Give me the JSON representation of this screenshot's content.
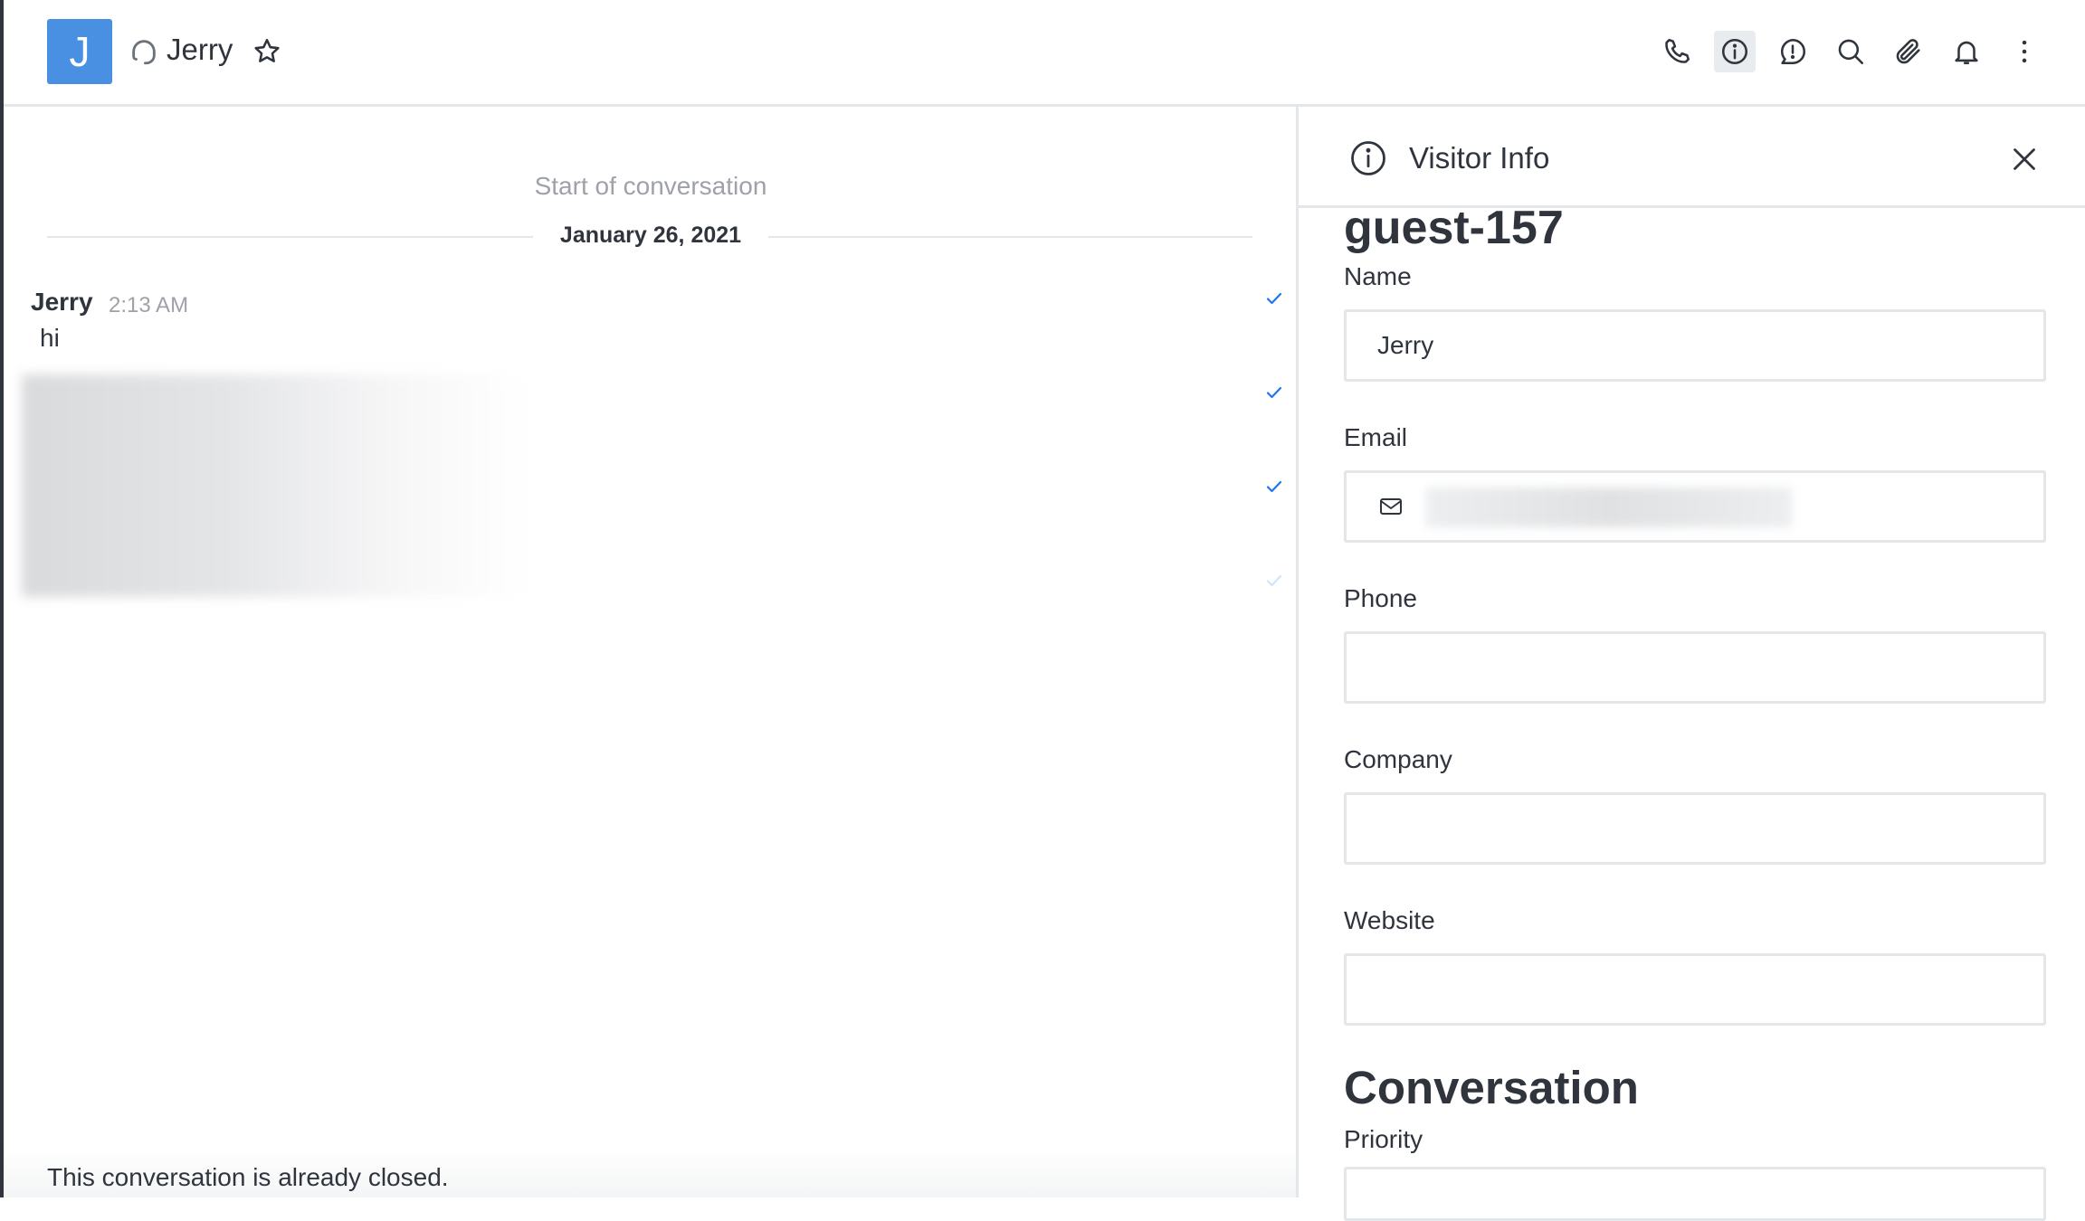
{
  "header": {
    "avatar_letter": "J",
    "room_name": "Jerry",
    "toolbar": [
      "phone-icon",
      "info-icon",
      "discussion-icon",
      "search-icon",
      "attachment-icon",
      "bell-icon",
      "kebab-menu-icon"
    ]
  },
  "chat": {
    "start_label": "Start of conversation",
    "date_label": "January 26, 2021",
    "message": {
      "author": "Jerry",
      "time": "2:13 AM",
      "text": "hi"
    },
    "closed_notice": "This conversation is already closed."
  },
  "panel": {
    "title": "Visitor Info",
    "guest_name": "guest-157",
    "fields": {
      "name_label": "Name",
      "name_value": "Jerry",
      "email_label": "Email",
      "phone_label": "Phone",
      "company_label": "Company",
      "website_label": "Website"
    },
    "section_title": "Conversation",
    "priority_label": "Priority"
  },
  "colors": {
    "accent": "#4a90e2",
    "border": "#e4e7ea",
    "text": "#2f343d",
    "muted": "#9ea2a8",
    "check": "#1d74f5"
  }
}
